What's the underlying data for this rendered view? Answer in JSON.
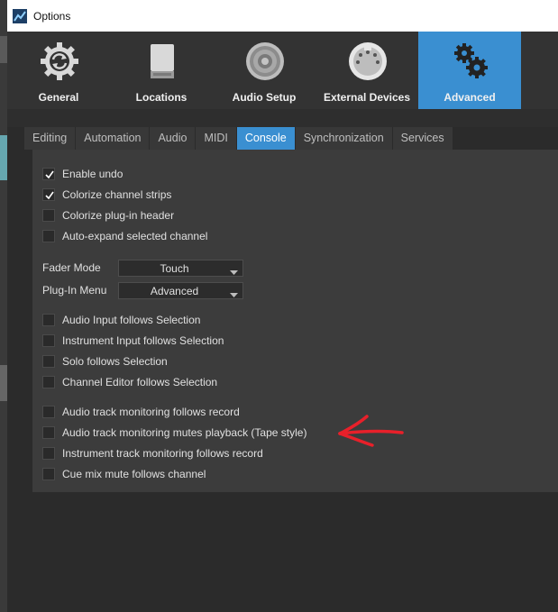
{
  "window": {
    "title": "Options"
  },
  "categories": [
    {
      "label": "General",
      "icon": "gear-refresh-icon",
      "active": false
    },
    {
      "label": "Locations",
      "icon": "drive-icon",
      "active": false
    },
    {
      "label": "Audio Setup",
      "icon": "speaker-icon",
      "active": false
    },
    {
      "label": "External Devices",
      "icon": "midi-port-icon",
      "active": false
    },
    {
      "label": "Advanced",
      "icon": "gears-icon",
      "active": true
    }
  ],
  "subtabs": [
    {
      "label": "Editing",
      "active": false
    },
    {
      "label": "Automation",
      "active": false
    },
    {
      "label": "Audio",
      "active": false
    },
    {
      "label": "MIDI",
      "active": false
    },
    {
      "label": "Console",
      "active": true
    },
    {
      "label": "Synchronization",
      "active": false
    },
    {
      "label": "Services",
      "active": false
    }
  ],
  "console": {
    "group1": [
      {
        "label": "Enable undo",
        "checked": true
      },
      {
        "label": "Colorize channel strips",
        "checked": true
      },
      {
        "label": "Colorize plug-in header",
        "checked": false
      },
      {
        "label": "Auto-expand selected channel",
        "checked": false
      }
    ],
    "fader_mode": {
      "label": "Fader Mode",
      "value": "Touch"
    },
    "plugin_menu": {
      "label": "Plug-In Menu",
      "value": "Advanced"
    },
    "group2": [
      {
        "label": "Audio Input follows Selection",
        "checked": false
      },
      {
        "label": "Instrument Input follows Selection",
        "checked": false
      },
      {
        "label": "Solo follows Selection",
        "checked": false
      },
      {
        "label": "Channel Editor follows Selection",
        "checked": false
      }
    ],
    "group3": [
      {
        "label": "Audio track monitoring follows record",
        "checked": false
      },
      {
        "label": "Audio track monitoring mutes playback (Tape style)",
        "checked": false
      },
      {
        "label": "Instrument track monitoring follows record",
        "checked": false
      },
      {
        "label": "Cue mix mute follows channel",
        "checked": false
      }
    ]
  },
  "colors": {
    "accent": "#3a8fd1",
    "annotation": "#e8202a"
  }
}
